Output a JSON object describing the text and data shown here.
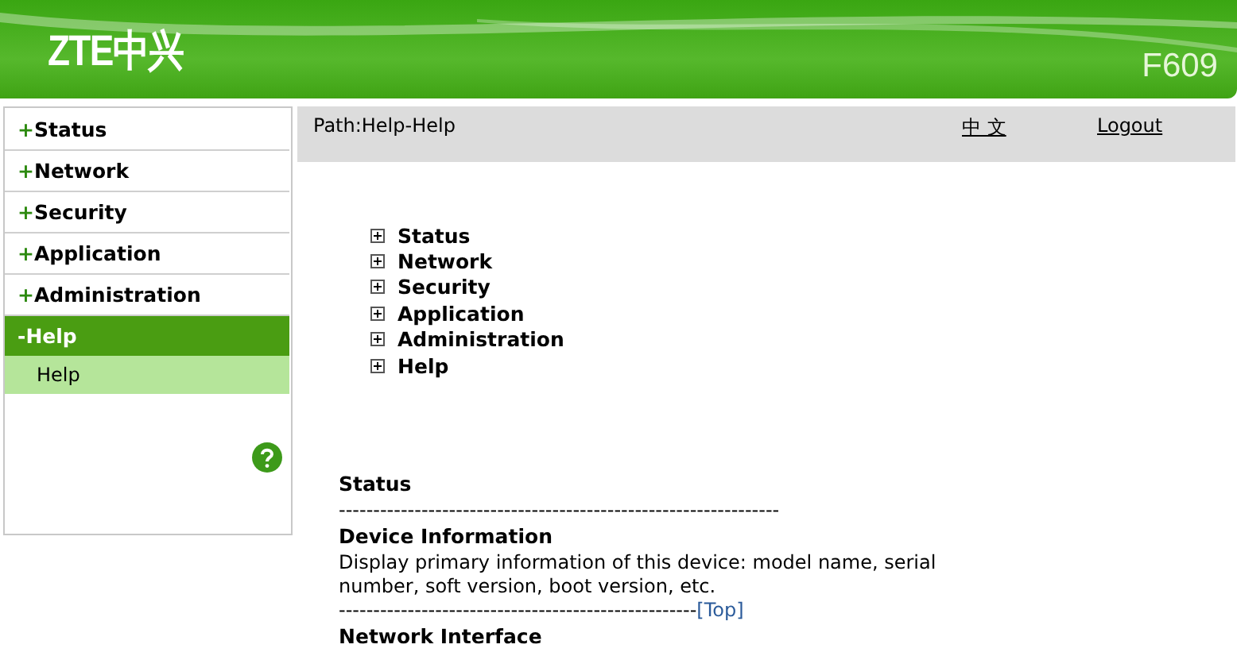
{
  "header": {
    "logo": "ZTE中兴",
    "model": "F609"
  },
  "sidebar": {
    "items": [
      {
        "label": "Status",
        "expanded": false
      },
      {
        "label": "Network",
        "expanded": false
      },
      {
        "label": "Security",
        "expanded": false
      },
      {
        "label": "Application",
        "expanded": false
      },
      {
        "label": "Administration",
        "expanded": false
      },
      {
        "label": "Help",
        "expanded": true,
        "children": [
          {
            "label": "Help",
            "selected": true
          }
        ]
      }
    ],
    "expand_sign": "+",
    "collapse_sign": "-"
  },
  "path_bar": {
    "path": "Path:Help-Help",
    "language_link": "中 文",
    "logout_link": "Logout"
  },
  "topics": [
    {
      "label": "Status",
      "expanded": false
    },
    {
      "label": "Network",
      "expanded": false
    },
    {
      "label": "Security",
      "expanded": false
    },
    {
      "label": "Application",
      "expanded": false
    },
    {
      "label": "Administration",
      "expanded": false
    },
    {
      "label": "Help",
      "expanded": false
    }
  ],
  "help": {
    "section_title": "Status",
    "separator": "----------------------------------------------------------------",
    "entries": [
      {
        "title": "Device Information",
        "description": "Display primary information of this device: model name, serial number, soft version, boot version, etc.",
        "separator": "----------------------------------------------------",
        "top_link": "[Top]"
      },
      {
        "title": "Network Interface"
      }
    ]
  }
}
